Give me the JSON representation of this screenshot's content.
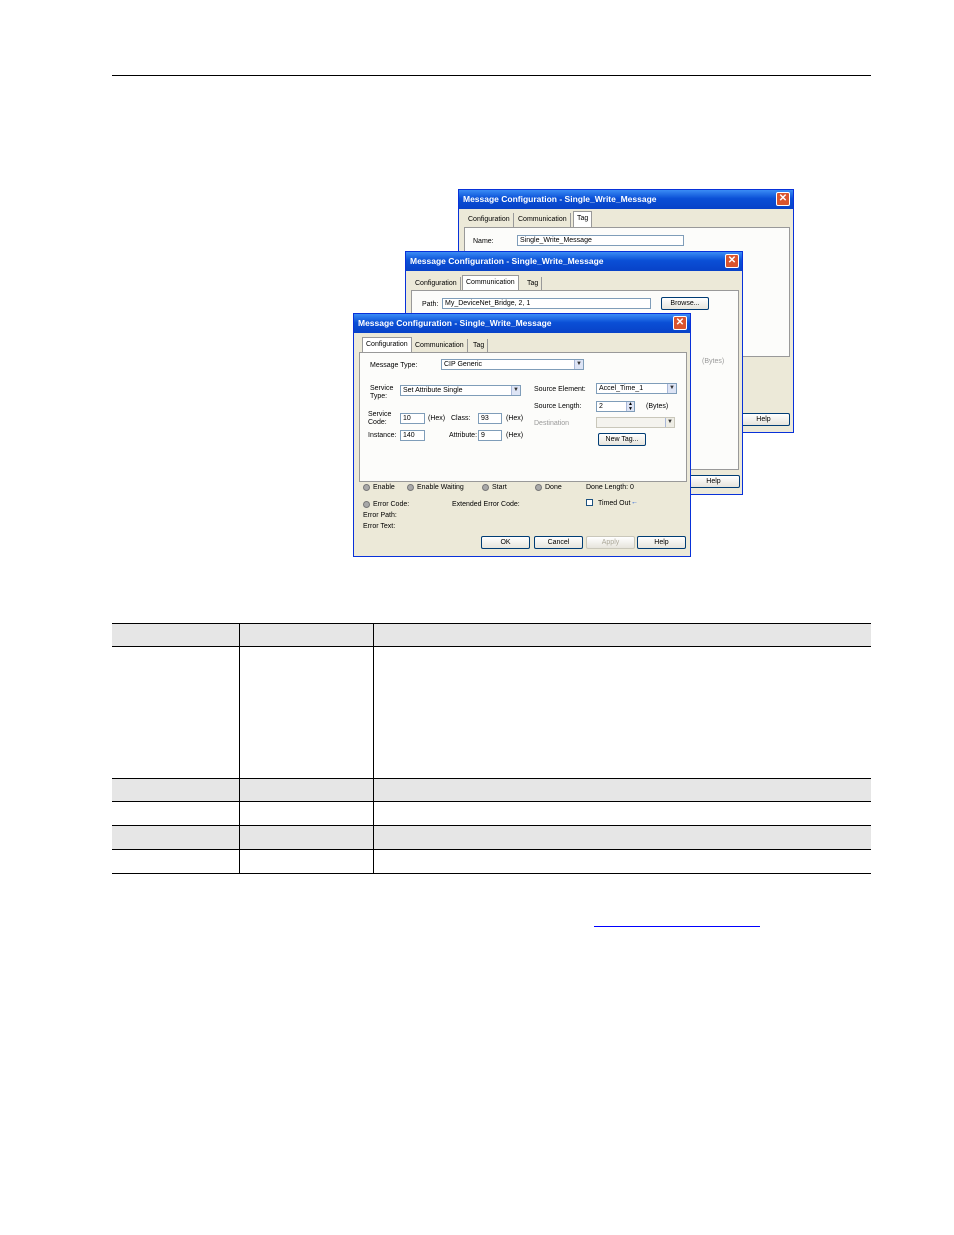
{
  "dialog_back": {
    "title": "Message Configuration - Single_Write_Message",
    "tabs": [
      "Configuration",
      "Communication",
      "Tag"
    ],
    "name_label": "Name:",
    "name_value": "Single_Write_Message",
    "help_label": "Help"
  },
  "dialog_mid": {
    "title": "Message Configuration - Single_Write_Message",
    "tabs": [
      "Configuration",
      "Communication",
      "Tag"
    ],
    "path_label": "Path:",
    "path_value": "My_DeviceNet_Bridge, 2, 1",
    "browse_label": "Browse...",
    "bytes_partial": "(Bytes)",
    "help_label": "Help"
  },
  "dialog_front": {
    "title": "Message Configuration - Single_Write_Message",
    "tabs": [
      "Configuration",
      "Communication",
      "Tag"
    ],
    "message_type_label": "Message Type:",
    "message_type_value": "CIP Generic",
    "service_type_label": "Service Type:",
    "service_type_value": "Set Attribute Single",
    "service_code_label": "Service Code:",
    "service_code_value": "10",
    "class_label": "Class:",
    "class_value": "93",
    "instance_label": "Instance:",
    "instance_value": "140",
    "attribute_label": "Attribute:",
    "attribute_value": "9",
    "hex_label": "(Hex)",
    "source_element_label": "Source Element:",
    "source_element_value": "Accel_Time_1",
    "source_length_label": "Source Length:",
    "source_length_value": "2",
    "bytes_label": "(Bytes)",
    "destination_label": "Destination",
    "new_tag_label": "New Tag...",
    "status": {
      "enable": "Enable",
      "enable_waiting": "Enable Waiting",
      "start": "Start",
      "done": "Done",
      "done_length": "Done Length: 0",
      "error_code": "Error Code:",
      "extended_error_code": "Extended Error Code:",
      "timed_out": "Timed Out",
      "error_path": "Error Path:",
      "error_text": "Error Text:"
    },
    "buttons": {
      "ok": "OK",
      "cancel": "Cancel",
      "apply": "Apply",
      "help": "Help"
    }
  }
}
